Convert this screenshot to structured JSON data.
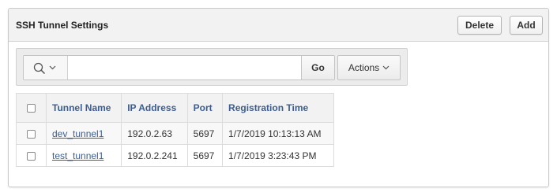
{
  "region": {
    "title": "SSH Tunnel Settings",
    "delete_label": "Delete",
    "add_label": "Add"
  },
  "toolbar": {
    "search_icon": "search-icon",
    "search_value": "",
    "go_label": "Go",
    "actions_label": "Actions"
  },
  "table": {
    "columns": [
      "Tunnel Name",
      "IP Address",
      "Port",
      "Registration Time"
    ],
    "rows": [
      {
        "name": "dev_tunnel1",
        "ip": "192.0.2.63",
        "port": "5697",
        "time": "1/7/2019 10:13:13 AM"
      },
      {
        "name": "test_tunnel1",
        "ip": "192.0.2.241",
        "port": "5697",
        "time": "1/7/2019 3:23:43 PM"
      }
    ]
  },
  "colors": {
    "link": "#3c5d91",
    "header_bg": "#f2f2f2"
  }
}
